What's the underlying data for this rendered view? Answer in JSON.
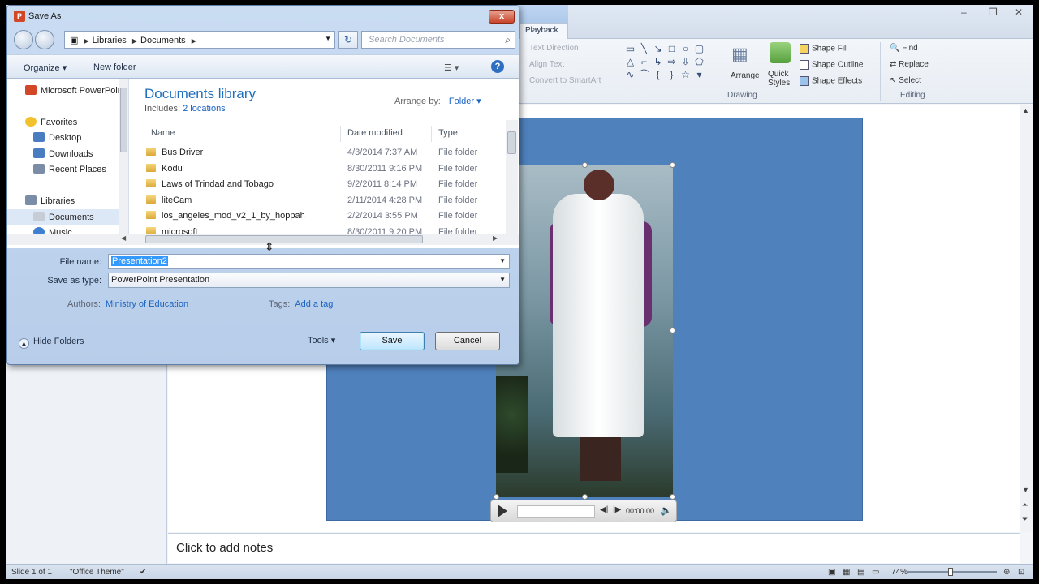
{
  "ppt": {
    "ribbon": {
      "tab_playback": "Playback",
      "text_direction": "Text Direction",
      "align_text": "Align Text",
      "convert_smartart": "Convert to SmartArt",
      "arrange": "Arrange",
      "quick_styles": "Quick Styles",
      "shape_fill": "Shape Fill",
      "shape_outline": "Shape Outline",
      "shape_effects": "Shape Effects",
      "find": "Find",
      "replace": "Replace",
      "select": "Select",
      "group_drawing": "Drawing",
      "group_editing": "Editing"
    },
    "media": {
      "time": "00:00.00"
    },
    "notes_placeholder": "Click to add notes",
    "status": {
      "slide": "Slide 1 of 1",
      "theme": "\"Office Theme\"",
      "zoom": "74%"
    }
  },
  "dialog": {
    "title": "Save As",
    "close_label": "x",
    "address": [
      "Libraries",
      "Documents"
    ],
    "search_placeholder": "Search Documents",
    "organize": "Organize",
    "new_folder": "New folder",
    "help": "?",
    "nav": [
      {
        "label": "Microsoft PowerPoint",
        "color": "#d24726"
      },
      {
        "label": "Favorites",
        "color": "#f2c12e"
      },
      {
        "label": "Desktop",
        "color": "#4a7cc2"
      },
      {
        "label": "Downloads",
        "color": "#4a7cc2"
      },
      {
        "label": "Recent Places",
        "color": "#7b8ca6"
      },
      {
        "label": "Libraries",
        "color": "#7b8ca6"
      },
      {
        "label": "Documents",
        "color": "#c7cdd6"
      },
      {
        "label": "Music",
        "color": "#3d7fd1"
      }
    ],
    "library_title": "Documents library",
    "includes_label": "Includes:",
    "includes_link": "2 locations",
    "arrange_label": "Arrange by:",
    "arrange_value": "Folder",
    "columns": {
      "name": "Name",
      "date": "Date modified",
      "type": "Type"
    },
    "files": [
      {
        "name": "Bus Driver",
        "date": "4/3/2014 7:37 AM",
        "type": "File folder"
      },
      {
        "name": "Kodu",
        "date": "8/30/2011 9:16 PM",
        "type": "File folder"
      },
      {
        "name": "Laws of Trindad and Tobago",
        "date": "9/2/2011 8:14 PM",
        "type": "File folder"
      },
      {
        "name": "liteCam",
        "date": "2/11/2014 4:28 PM",
        "type": "File folder"
      },
      {
        "name": "los_angeles_mod_v2_1_by_hoppah",
        "date": "2/2/2014 3:55 PM",
        "type": "File folder"
      },
      {
        "name": "microsoft",
        "date": "8/30/2011 9:20 PM",
        "type": "File folder"
      }
    ],
    "file_name_label": "File name:",
    "file_name_value": "Presentation2",
    "save_type_label": "Save as type:",
    "save_type_value": "PowerPoint Presentation",
    "authors_label": "Authors:",
    "authors_value": "Ministry of Education",
    "tags_label": "Tags:",
    "tags_value": "Add a tag",
    "hide_folders": "Hide Folders",
    "tools": "Tools",
    "save": "Save",
    "cancel": "Cancel"
  }
}
